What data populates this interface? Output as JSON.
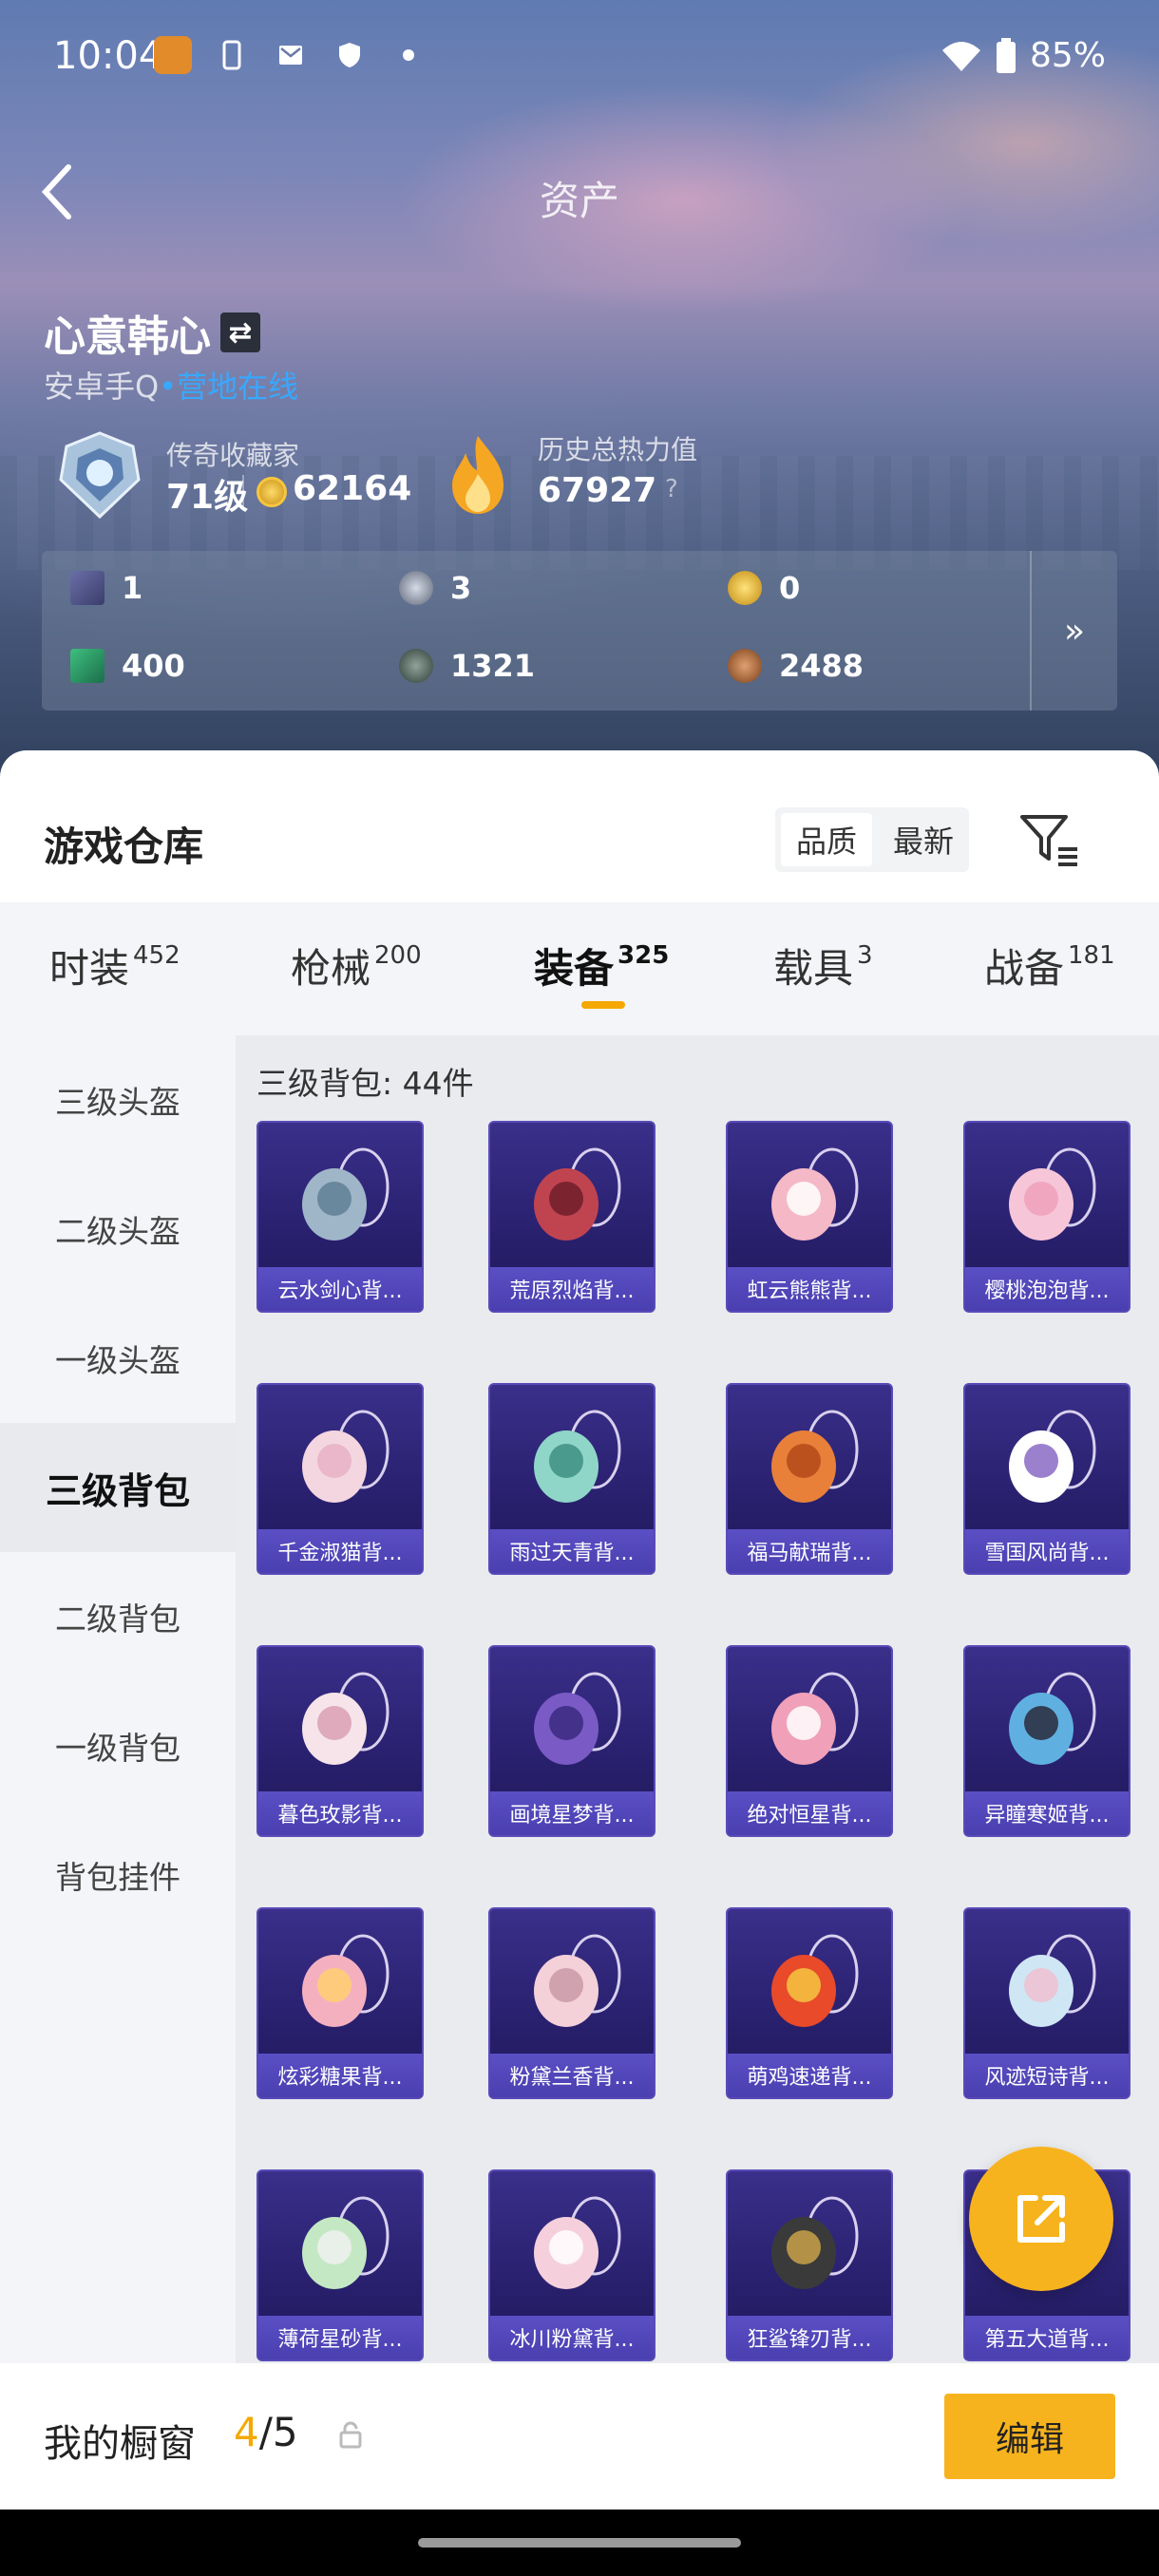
{
  "status_bar": {
    "time": "10:04",
    "battery": "85%",
    "icons": [
      "game-notification-icon",
      "phone-link-icon",
      "mail-icon",
      "shield-icon",
      "dot-icon"
    ]
  },
  "header": {
    "title": "资产",
    "back_icon": "chevron-left-icon"
  },
  "profile": {
    "username": "心意韩心",
    "platform": "安卓手Q",
    "status": "营地在线",
    "rank_label": "传奇收藏家",
    "rank_level": "71级",
    "rank_points": "62164",
    "heat_label": "历史总热力值",
    "heat_value": "67927",
    "heat_help": "?"
  },
  "currency": [
    {
      "icon": "card-icon",
      "value": "1"
    },
    {
      "icon": "silver-coin-icon",
      "value": "3"
    },
    {
      "icon": "gold-coin-icon",
      "value": "0"
    },
    {
      "icon": "green-card-icon",
      "value": "400"
    },
    {
      "icon": "dark-orb-icon",
      "value": "1321"
    },
    {
      "icon": "bronze-coin-icon",
      "value": "2488"
    }
  ],
  "warehouse": {
    "title": "游戏仓库",
    "sort_options": [
      "品质",
      "最新"
    ],
    "sort_selected": "品质"
  },
  "tabs": [
    {
      "label": "时装",
      "count": "452"
    },
    {
      "label": "枪械",
      "count": "200"
    },
    {
      "label": "装备",
      "count": "325",
      "active": true
    },
    {
      "label": "载具",
      "count": "3"
    },
    {
      "label": "战备",
      "count": "181"
    }
  ],
  "sidebar": [
    "三级头盔",
    "二级头盔",
    "一级头盔",
    "三级背包",
    "二级背包",
    "一级背包",
    "背包挂件"
  ],
  "sidebar_selected": "三级背包",
  "category_count": "三级背包: 44件",
  "items": [
    "云水剑心背...",
    "荒原烈焰背...",
    "虹云熊熊背...",
    "樱桃泡泡背...",
    "千金淑猫背...",
    "雨过天青背...",
    "福马献瑞背...",
    "雪国风尚背...",
    "暮色玫影背...",
    "画境星梦背...",
    "绝对恒星背...",
    "异瞳寒姬背...",
    "炫彩糖果背...",
    "粉黛兰香背...",
    "萌鸡速递背...",
    "风迹短诗背...",
    "薄荷星砂背...",
    "冰川粉黛背...",
    "狂鲨锋刃背...",
    "第五大道背..."
  ],
  "bottom": {
    "window_label": "我的橱窗",
    "window_current": "4",
    "window_total": "/5",
    "edit_label": "编辑"
  },
  "colors": {
    "accent": "#f7b31d",
    "online": "#38a8ff",
    "item_bg": "#2a2170",
    "item_label": "#4a3fb0"
  }
}
